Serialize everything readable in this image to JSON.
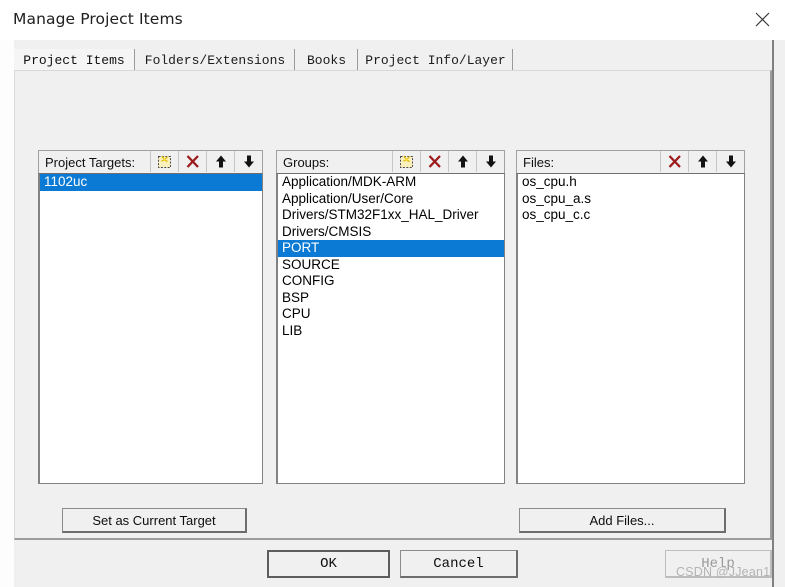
{
  "window": {
    "title": "Manage Project Items",
    "close_icon": "close-icon"
  },
  "tabs": [
    {
      "label": "Project Items",
      "active": true
    },
    {
      "label": "Folders/Extensions",
      "active": false
    },
    {
      "label": "Books",
      "active": false
    },
    {
      "label": "Project Info/Layer",
      "active": false
    }
  ],
  "columns": {
    "targets": {
      "header": "Project Targets:",
      "tools": [
        "new-item-icon",
        "delete-icon",
        "move-up-icon",
        "move-down-icon"
      ],
      "items": [
        {
          "label": "1102uc",
          "selected": true
        }
      ]
    },
    "groups": {
      "header": "Groups:",
      "tools": [
        "new-item-icon",
        "delete-icon",
        "move-up-icon",
        "move-down-icon"
      ],
      "items": [
        {
          "label": "Application/MDK-ARM",
          "selected": false
        },
        {
          "label": "Application/User/Core",
          "selected": false
        },
        {
          "label": "Drivers/STM32F1xx_HAL_Driver",
          "selected": false
        },
        {
          "label": "Drivers/CMSIS",
          "selected": false
        },
        {
          "label": "PORT",
          "selected": true
        },
        {
          "label": "SOURCE",
          "selected": false
        },
        {
          "label": "CONFIG",
          "selected": false
        },
        {
          "label": "BSP",
          "selected": false
        },
        {
          "label": "CPU",
          "selected": false
        },
        {
          "label": "LIB",
          "selected": false
        }
      ]
    },
    "files": {
      "header": "Files:",
      "tools": [
        "delete-icon",
        "move-up-icon",
        "move-down-icon"
      ],
      "items": [
        {
          "label": "os_cpu.h",
          "selected": false
        },
        {
          "label": "os_cpu_a.s",
          "selected": false
        },
        {
          "label": "os_cpu_c.c",
          "selected": false
        }
      ]
    }
  },
  "actions": {
    "set_current_target": "Set as Current Target",
    "add_files": "Add Files..."
  },
  "footer": {
    "ok": "OK",
    "cancel": "Cancel",
    "help": "Help"
  },
  "watermark": "CSDN @JJean1",
  "colors": {
    "selection": "#0b7ad5",
    "dialog_bg": "#f0f0f0",
    "delete_icon": "#9c1b1b"
  }
}
